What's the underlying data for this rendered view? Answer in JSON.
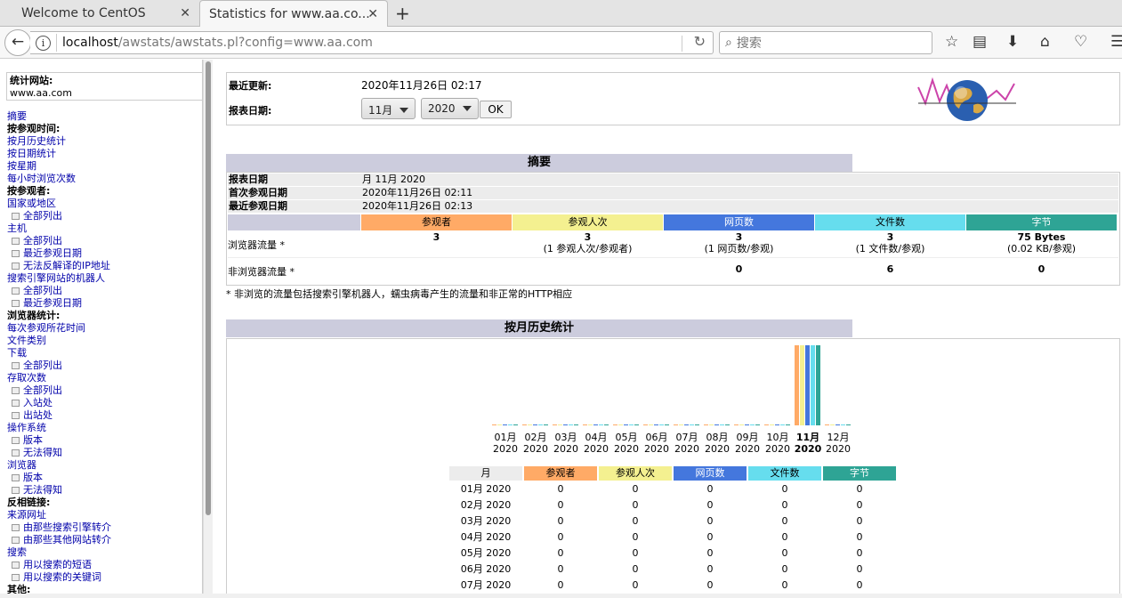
{
  "tabs": [
    {
      "title": "Welcome to CentOS"
    },
    {
      "title": "Statistics for www.aa.co..."
    }
  ],
  "url": {
    "host": "localhost",
    "path": "/awstats/awstats.pl?config=www.aa.com"
  },
  "search": {
    "placeholder": "搜索"
  },
  "sidebar": {
    "site_label": "统计网站:",
    "site_value": "www.aa.com",
    "items": [
      {
        "t": "摘要",
        "k": "l"
      },
      {
        "t": "按参观时间:",
        "k": "h"
      },
      {
        "t": "按月历史统计",
        "k": "l"
      },
      {
        "t": "按日期统计",
        "k": "l"
      },
      {
        "t": "按星期",
        "k": "l"
      },
      {
        "t": "每小时浏览次数",
        "k": "l"
      },
      {
        "t": "按参观者:",
        "k": "h"
      },
      {
        "t": "国家或地区",
        "k": "l"
      },
      {
        "t": "全部列出",
        "k": "s"
      },
      {
        "t": "主机",
        "k": "l"
      },
      {
        "t": "全部列出",
        "k": "s"
      },
      {
        "t": "最近参观日期",
        "k": "s"
      },
      {
        "t": "无法反解译的IP地址",
        "k": "s"
      },
      {
        "t": "搜索引擎网站的机器人",
        "k": "l"
      },
      {
        "t": "全部列出",
        "k": "s"
      },
      {
        "t": "最近参观日期",
        "k": "s"
      },
      {
        "t": "浏览器统计:",
        "k": "h"
      },
      {
        "t": "每次参观所花时间",
        "k": "l"
      },
      {
        "t": "文件类别",
        "k": "l"
      },
      {
        "t": "下载",
        "k": "l"
      },
      {
        "t": "全部列出",
        "k": "s"
      },
      {
        "t": "存取次数",
        "k": "l"
      },
      {
        "t": "全部列出",
        "k": "s"
      },
      {
        "t": "入站处",
        "k": "s"
      },
      {
        "t": "出站处",
        "k": "s"
      },
      {
        "t": "操作系统",
        "k": "l"
      },
      {
        "t": "版本",
        "k": "s"
      },
      {
        "t": "无法得知",
        "k": "s"
      },
      {
        "t": "浏览器",
        "k": "l"
      },
      {
        "t": "版本",
        "k": "s"
      },
      {
        "t": "无法得知",
        "k": "s"
      },
      {
        "t": "反相链接:",
        "k": "h"
      },
      {
        "t": "来源网址",
        "k": "l"
      },
      {
        "t": "由那些搜索引擎转介",
        "k": "s"
      },
      {
        "t": "由那些其他网站转介",
        "k": "s"
      },
      {
        "t": "搜索",
        "k": "l"
      },
      {
        "t": "用以搜索的短语",
        "k": "s"
      },
      {
        "t": "用以搜索的关键词",
        "k": "s"
      },
      {
        "t": "其他:",
        "k": "h"
      }
    ]
  },
  "top": {
    "updated_label": "最近更新:",
    "updated_value": "2020年11月26日 02:17",
    "report_label": "报表日期:",
    "month_select": "11月",
    "year_select": "2020",
    "ok": "OK"
  },
  "summary": {
    "title": "摘要",
    "rows": [
      {
        "k": "报表日期",
        "v": "月 11月 2020"
      },
      {
        "k": "首次参观日期",
        "v": "2020年11月26日 02:11"
      },
      {
        "k": "最近参观日期",
        "v": "2020年11月26日 02:13"
      }
    ],
    "columns": [
      {
        "label": "参观者",
        "color": "#ffaa66"
      },
      {
        "label": "参观人次",
        "color": "#f4f090"
      },
      {
        "label": "网页数",
        "color": "#4477dd"
      },
      {
        "label": "文件数",
        "color": "#66ddee"
      },
      {
        "label": "字节",
        "color": "#2ea495"
      }
    ],
    "browser_label": "浏览器流量 *",
    "browser_vals": [
      "3",
      "3",
      "3",
      "3",
      "75 Bytes"
    ],
    "browser_subs": [
      "",
      "(1 参观人次/参观者)",
      "(1 网页数/参观)",
      "(1 文件数/参观)",
      "(0.02 KB/参观)"
    ],
    "nonbrowser_label": "非浏览器流量 *",
    "nonbrowser_vals": [
      "",
      "",
      "0",
      "6",
      "0"
    ],
    "note": "* 非浏览的流量包括搜索引擎机器人，蠕虫病毒产生的流量和非正常的HTTP相应"
  },
  "history": {
    "title": "按月历史统计",
    "month_col": "月",
    "rows": [
      {
        "m": "01月 2020",
        "v": [
          "0",
          "0",
          "0",
          "0",
          "0"
        ]
      },
      {
        "m": "02月 2020",
        "v": [
          "0",
          "0",
          "0",
          "0",
          "0"
        ]
      },
      {
        "m": "03月 2020",
        "v": [
          "0",
          "0",
          "0",
          "0",
          "0"
        ]
      },
      {
        "m": "04月 2020",
        "v": [
          "0",
          "0",
          "0",
          "0",
          "0"
        ]
      },
      {
        "m": "05月 2020",
        "v": [
          "0",
          "0",
          "0",
          "0",
          "0"
        ]
      },
      {
        "m": "06月 2020",
        "v": [
          "0",
          "0",
          "0",
          "0",
          "0"
        ]
      },
      {
        "m": "07月 2020",
        "v": [
          "0",
          "0",
          "0",
          "0",
          "0"
        ]
      }
    ]
  },
  "chart_data": {
    "type": "bar",
    "categories": [
      "01月 2020",
      "02月 2020",
      "03月 2020",
      "04月 2020",
      "05月 2020",
      "06月 2020",
      "07月 2020",
      "08月 2020",
      "09月 2020",
      "10月 2020",
      "11月 2020",
      "12月 2020"
    ],
    "month_labels": [
      "01月",
      "02月",
      "03月",
      "04月",
      "05月",
      "06月",
      "07月",
      "08月",
      "09月",
      "10月",
      "11月",
      "12月"
    ],
    "year_label": "2020",
    "highlight_index": 10,
    "series": [
      {
        "name": "参观者",
        "color": "#ffaa66",
        "values": [
          0,
          0,
          0,
          0,
          0,
          0,
          0,
          0,
          0,
          0,
          3,
          0
        ]
      },
      {
        "name": "参观人次",
        "color": "#f4f090",
        "values": [
          0,
          0,
          0,
          0,
          0,
          0,
          0,
          0,
          0,
          0,
          3,
          0
        ]
      },
      {
        "name": "网页数",
        "color": "#4477dd",
        "values": [
          0,
          0,
          0,
          0,
          0,
          0,
          0,
          0,
          0,
          0,
          3,
          0
        ]
      },
      {
        "name": "文件数",
        "color": "#66ddee",
        "values": [
          0,
          0,
          0,
          0,
          0,
          0,
          0,
          0,
          0,
          0,
          3,
          0
        ]
      },
      {
        "name": "字节",
        "color": "#2ea495",
        "values": [
          0,
          0,
          0,
          0,
          0,
          0,
          0,
          0,
          0,
          0,
          75,
          0
        ]
      }
    ]
  }
}
